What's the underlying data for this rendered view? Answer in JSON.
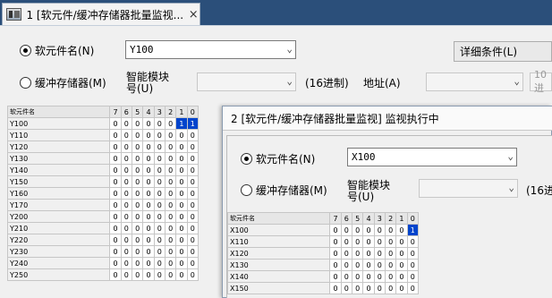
{
  "tab": {
    "title": "1 [软元件/缓冲存储器批量监视...",
    "close": "×"
  },
  "window1": {
    "device_radio_label": "软元件名(N)",
    "device_value": "Y100",
    "detail_button": "详细条件(L)",
    "buffer_radio_label": "缓冲存储器(M)",
    "smart_module_label_line1": "智能模块",
    "smart_module_label_line2": "号(U)",
    "hex_label": "(16进制)",
    "address_label": "地址(A)",
    "address_hex_cut": "10进",
    "grid_header": {
      "name": "软元件名",
      "bits": [
        "7",
        "6",
        "5",
        "4",
        "3",
        "2",
        "1",
        "0"
      ]
    },
    "rows": [
      {
        "name": "Y100",
        "bits": [
          "0",
          "0",
          "0",
          "0",
          "0",
          "0",
          "1",
          "1"
        ],
        "selected": [
          6,
          7
        ]
      },
      {
        "name": "Y110",
        "bits": [
          "0",
          "0",
          "0",
          "0",
          "0",
          "0",
          "0",
          "0"
        ]
      },
      {
        "name": "Y120",
        "bits": [
          "0",
          "0",
          "0",
          "0",
          "0",
          "0",
          "0",
          "0"
        ]
      },
      {
        "name": "Y130",
        "bits": [
          "0",
          "0",
          "0",
          "0",
          "0",
          "0",
          "0",
          "0"
        ]
      },
      {
        "name": "Y140",
        "bits": [
          "0",
          "0",
          "0",
          "0",
          "0",
          "0",
          "0",
          "0"
        ]
      },
      {
        "name": "Y150",
        "bits": [
          "0",
          "0",
          "0",
          "0",
          "0",
          "0",
          "0",
          "0"
        ]
      },
      {
        "name": "Y160",
        "bits": [
          "0",
          "0",
          "0",
          "0",
          "0",
          "0",
          "0",
          "0"
        ]
      },
      {
        "name": "Y170",
        "bits": [
          "0",
          "0",
          "0",
          "0",
          "0",
          "0",
          "0",
          "0"
        ]
      },
      {
        "name": "Y200",
        "bits": [
          "0",
          "0",
          "0",
          "0",
          "0",
          "0",
          "0",
          "0"
        ]
      },
      {
        "name": "Y210",
        "bits": [
          "0",
          "0",
          "0",
          "0",
          "0",
          "0",
          "0",
          "0"
        ]
      },
      {
        "name": "Y220",
        "bits": [
          "0",
          "0",
          "0",
          "0",
          "0",
          "0",
          "0",
          "0"
        ]
      },
      {
        "name": "Y230",
        "bits": [
          "0",
          "0",
          "0",
          "0",
          "0",
          "0",
          "0",
          "0"
        ]
      },
      {
        "name": "Y240",
        "bits": [
          "0",
          "0",
          "0",
          "0",
          "0",
          "0",
          "0",
          "0"
        ]
      },
      {
        "name": "Y250",
        "bits": [
          "0",
          "0",
          "0",
          "0",
          "0",
          "0",
          "0",
          "0"
        ]
      }
    ]
  },
  "window2": {
    "title": "2 [软元件/缓冲存储器批量监视] 监视执行中",
    "device_radio_label": "软元件名(N)",
    "device_value": "X100",
    "buffer_radio_label": "缓冲存储器(M)",
    "smart_module_label_line1": "智能模块",
    "smart_module_label_line2": "号(U)",
    "hex_label_cut": "(16进",
    "grid_header": {
      "name": "软元件名",
      "bits": [
        "7",
        "6",
        "5",
        "4",
        "3",
        "2",
        "1",
        "0"
      ]
    },
    "rows": [
      {
        "name": "X100",
        "bits": [
          "0",
          "0",
          "0",
          "0",
          "0",
          "0",
          "0",
          "1"
        ],
        "selected": [
          7
        ]
      },
      {
        "name": "X110",
        "bits": [
          "0",
          "0",
          "0",
          "0",
          "0",
          "0",
          "0",
          "0"
        ]
      },
      {
        "name": "X120",
        "bits": [
          "0",
          "0",
          "0",
          "0",
          "0",
          "0",
          "0",
          "0"
        ]
      },
      {
        "name": "X130",
        "bits": [
          "0",
          "0",
          "0",
          "0",
          "0",
          "0",
          "0",
          "0"
        ]
      },
      {
        "name": "X140",
        "bits": [
          "0",
          "0",
          "0",
          "0",
          "0",
          "0",
          "0",
          "0"
        ]
      },
      {
        "name": "X150",
        "bits": [
          "0",
          "0",
          "0",
          "0",
          "0",
          "0",
          "0",
          "0"
        ]
      }
    ]
  }
}
